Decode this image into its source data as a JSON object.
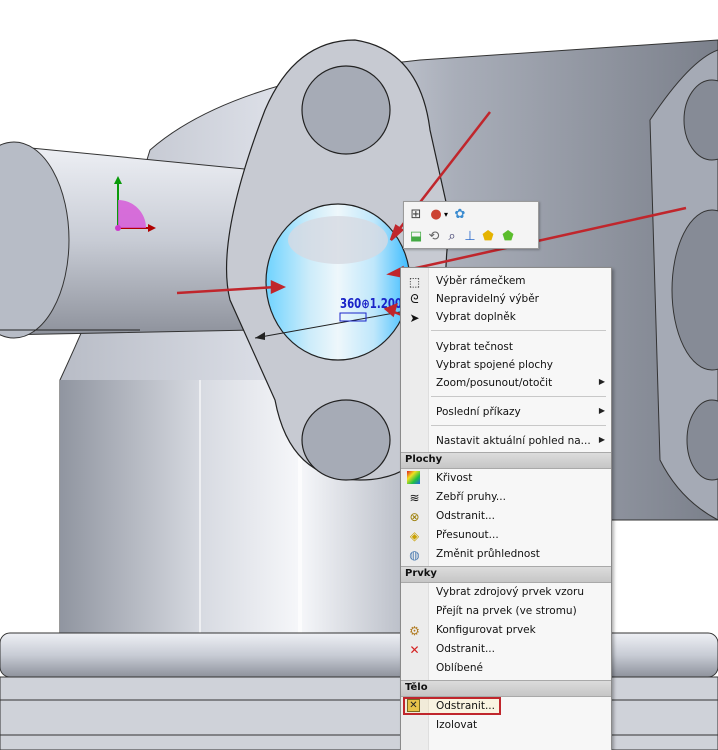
{
  "model": {
    "dimension_text": "360⊕1.200"
  },
  "context_toolbar": {
    "icons": [
      "sketch-icon",
      "appearance-color-icon",
      "display-style-icon",
      "zoom-to-selection-icon",
      "view-orientation-icon",
      "section-view-icon",
      "normal-to-icon",
      "edit-color-icon",
      "edit-appearance-icon"
    ]
  },
  "context_menu": {
    "items_top": [
      {
        "label": "Výběr rámečkem",
        "icon": "box-select-icon"
      },
      {
        "label": "Nepravidelný výběr",
        "icon": "lasso-select-icon"
      },
      {
        "label": "Vybrat doplněk",
        "icon": "select-other-icon"
      },
      {
        "label": "Vybrat tečnost"
      },
      {
        "label": "Vybrat spojené plochy"
      },
      {
        "label": "Zoom/posunout/otočit",
        "submenu": true
      },
      {
        "label": "Poslední příkazy",
        "submenu": true
      },
      {
        "label": "Nastavit aktuální pohled na...",
        "submenu": true
      }
    ],
    "sections": [
      {
        "title": "Plochy",
        "items": [
          {
            "label": "Křivost",
            "icon": "curvature-icon"
          },
          {
            "label": "Zebří pruhy...",
            "icon": "zebra-stripes-icon"
          },
          {
            "label": "Odstranit...",
            "icon": "delete-face-icon"
          },
          {
            "label": "Přesunout...",
            "icon": "move-face-icon"
          },
          {
            "label": "Změnit průhlednost",
            "icon": "transparency-icon"
          }
        ]
      },
      {
        "title": "Prvky",
        "items": [
          {
            "label": "Vybrat zdrojový prvek vzoru"
          },
          {
            "label": "Přejít na prvek (ve stromu)"
          },
          {
            "label": "Konfigurovat prvek",
            "icon": "configure-feature-icon"
          },
          {
            "label": "Odstranit...",
            "icon": "delete-red-x-icon"
          },
          {
            "label": "Oblíbené"
          }
        ]
      },
      {
        "title": "Tělo",
        "items": [
          {
            "label": "Odstranit...",
            "icon": "delete-body-icon",
            "highlighted": true
          },
          {
            "label": "Izolovat"
          }
        ]
      }
    ]
  },
  "colors": {
    "highlight_box": "#c0262c",
    "annotation_arrow": "#c0262c",
    "selected_face": "#4fc3ff"
  }
}
